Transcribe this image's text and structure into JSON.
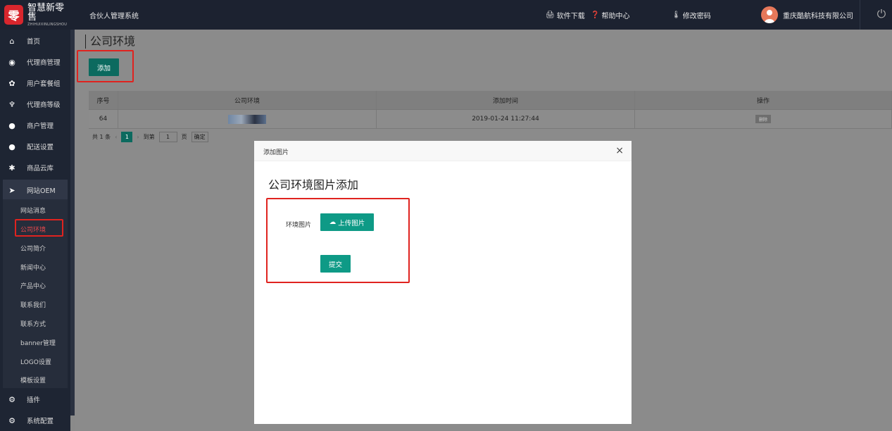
{
  "topbar": {
    "logo_char": "零",
    "logo_cn": "智慧新零售",
    "logo_en": "ZHIHUIXINLINGSHOU",
    "system_title": "合伙人管理系统",
    "download_label": "软件下载",
    "help_label": "帮助中心",
    "password_label": "修改密码",
    "company_name": "重庆酷航科技有限公司"
  },
  "sidebar": {
    "items": [
      {
        "label": "首页",
        "icon": "home-icon",
        "glyph": "⌂"
      },
      {
        "label": "代理商管理",
        "icon": "agent-icon",
        "glyph": "◉"
      },
      {
        "label": "用户套餐组",
        "icon": "package-icon",
        "glyph": "✿"
      },
      {
        "label": "代理商等级",
        "icon": "level-icon",
        "glyph": "♆"
      },
      {
        "label": "商户管理",
        "icon": "merchant-icon",
        "glyph": "●"
      },
      {
        "label": "配送设置",
        "icon": "delivery-icon",
        "glyph": "●"
      },
      {
        "label": "商品云库",
        "icon": "cloud-goods-icon",
        "glyph": "✱"
      },
      {
        "label": "网站OEM",
        "icon": "telegram-icon",
        "glyph": "➤"
      }
    ],
    "sub_items": [
      {
        "label": "网站消息"
      },
      {
        "label": "公司环境"
      },
      {
        "label": "公司简介"
      },
      {
        "label": "新闻中心"
      },
      {
        "label": "产品中心"
      },
      {
        "label": "联系我们"
      },
      {
        "label": "联系方式"
      },
      {
        "label": "banner管理"
      },
      {
        "label": "LOGO设置"
      },
      {
        "label": "模板设置"
      }
    ],
    "bottom_items": [
      {
        "label": "插件",
        "icon": "plugin-icon",
        "glyph": "⚙"
      },
      {
        "label": "系统配置",
        "icon": "settings-icon",
        "glyph": "⚙"
      }
    ]
  },
  "main": {
    "page_title": "公司环境",
    "add_label": "添加",
    "table": {
      "headers": [
        "序号",
        "公司环境",
        "添加时间",
        "操作"
      ],
      "rows": [
        {
          "id": "64",
          "time": "2019-01-24 11:27:44",
          "action": "删除"
        }
      ]
    },
    "pager": {
      "total": "共 1 条",
      "current": "1",
      "goto_label": "到第",
      "goto_value": "1",
      "page_label": "页",
      "confirm_label": "确定"
    }
  },
  "modal": {
    "title": "添加图片",
    "close": "×",
    "heading": "公司环境图片添加",
    "field_label": "环境图片",
    "upload_label": "上传图片",
    "submit_label": "提交"
  },
  "colors": {
    "topbar_bg": "#1c2230",
    "sidebar_bg": "#1e2533",
    "primary_button": "#0e9a86",
    "highlight_red": "#e0231f"
  }
}
